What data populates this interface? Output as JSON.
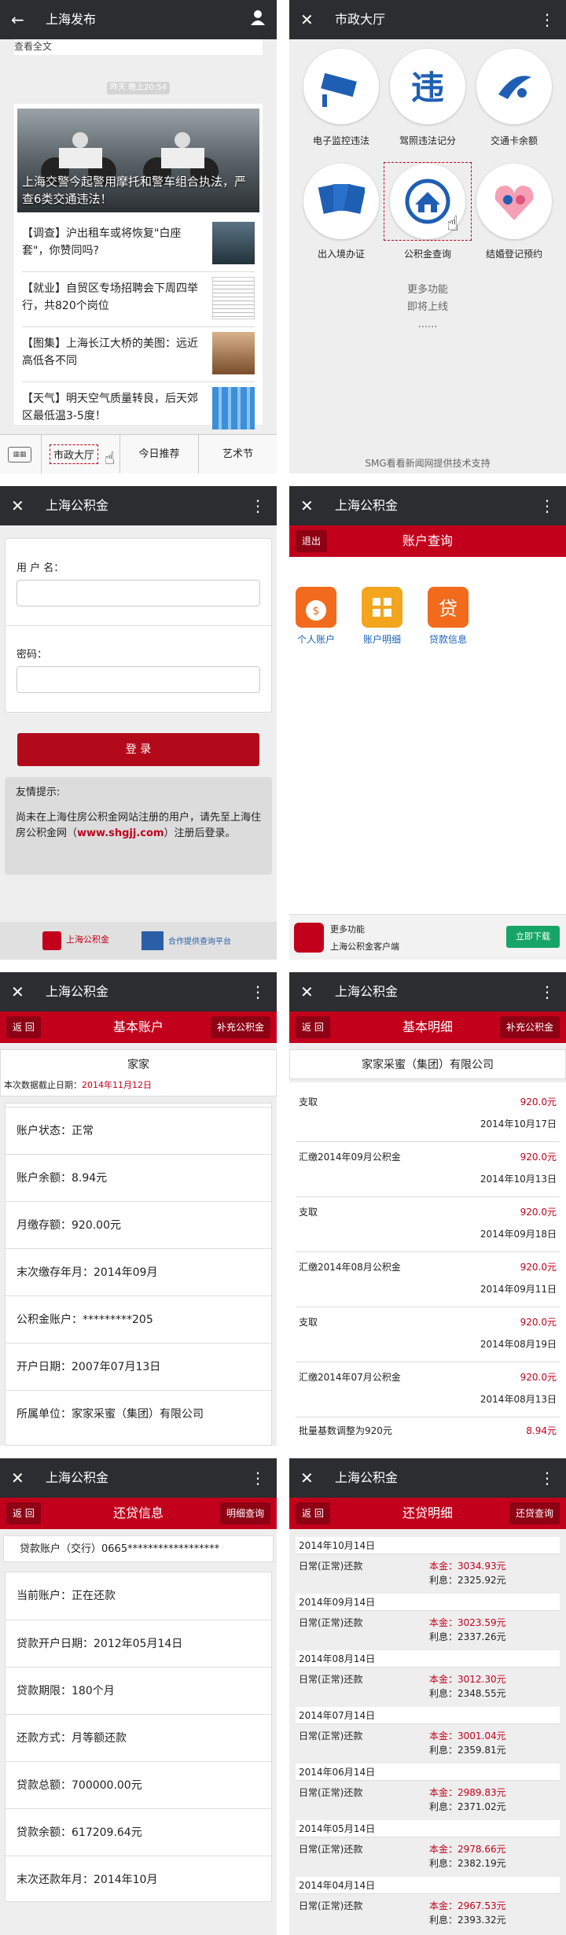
{
  "panel1": {
    "title": "上海发布",
    "top_text": "查看全文",
    "time": "昨天 晚上20:54",
    "headline": "上海交警今起警用摩托和警车组合执法，严查6类交通违法！",
    "items": [
      {
        "text": "【调查】沪出租车或将恢复\"白座套\"，你赞同吗?"
      },
      {
        "text": "【就业】自贸区专场招聘会下周四举行，共820个岗位"
      },
      {
        "text": "【图集】上海长江大桥的美图：远近高低各不同"
      },
      {
        "text": "【天气】明天空气质量转良，后天郊区最低温3-5度！"
      }
    ],
    "menu": [
      "市政大厅",
      "今日推荐",
      "艺术节"
    ]
  },
  "panel2": {
    "title": "市政大厅",
    "icons": [
      {
        "label": "电子监控违法",
        "icon": "camera-icon"
      },
      {
        "label": "驾照违法记分",
        "icon": "violation-icon"
      },
      {
        "label": "交通卡余额",
        "icon": "transport-card-icon"
      },
      {
        "label": "出入境办证",
        "icon": "passport-icon"
      },
      {
        "label": "公积金查询",
        "icon": "housing-fund-icon"
      },
      {
        "label": "结婚登记预约",
        "icon": "marriage-icon"
      }
    ],
    "more1": "更多功能",
    "more2": "即将上线",
    "more3": "......",
    "footer": "SMG看看新闻网提供技术支持"
  },
  "panel3": {
    "title": "上海公积金",
    "user_label": "用 户 名：",
    "pwd_label": "密码：",
    "login": "登 录",
    "tip_title": "友情提示:",
    "tip_text1": "尚未在上海住房公积金网站注册的用户，请先至上海住房公积金网（",
    "tip_link": "www.shgjj.com",
    "tip_text2": "）注册后登录。",
    "foot_left": "上海公积金",
    "foot_right": "合作提供查询平台"
  },
  "panel4": {
    "title": "上海公积金",
    "back": "退出",
    "header": "账户查询",
    "icons": [
      {
        "label": "个人账户",
        "color": "#f26b1d"
      },
      {
        "label": "账户明细",
        "color": "#f2a51d"
      },
      {
        "label": "贷款信息",
        "color": "#f26b1d"
      }
    ],
    "ad_line1": "更多功能",
    "ad_line2": "上海公积金客户端",
    "ad_btn": "立即下载"
  },
  "panel5": {
    "title": "上海公积金",
    "back": "返 回",
    "header": "基本账户",
    "extra": "补充公积金",
    "name": "家家",
    "date_label": "本次数据截止日期：",
    "date": "2014年11月12日",
    "rows": [
      "账户状态：正常",
      "账户余额：8.94元",
      "月缴存额：920.00元",
      "末次缴存年月：2014年09月",
      "公积金账户：*********205",
      "开户日期：2007年07月13日",
      "所属单位：家家采蜜（集团）有限公司"
    ]
  },
  "panel6": {
    "title": "上海公积金",
    "back": "返 回",
    "header": "基本明细",
    "extra": "补充公积金",
    "company": "家家采蜜（集团）有限公司",
    "rows": [
      {
        "type": "支取",
        "amount": "920.0元",
        "date": "2014年10月17日"
      },
      {
        "type": "汇缴2014年09月公积金",
        "amount": "920.0元",
        "date": "2014年10月13日"
      },
      {
        "type": "支取",
        "amount": "920.0元",
        "date": "2014年09月18日"
      },
      {
        "type": "汇缴2014年08月公积金",
        "amount": "920.0元",
        "date": "2014年09月11日"
      },
      {
        "type": "支取",
        "amount": "920.0元",
        "date": "2014年08月19日"
      },
      {
        "type": "汇缴2014年07月公积金",
        "amount": "920.0元",
        "date": "2014年08月13日"
      }
    ],
    "last_type": "批量基数调整为920元",
    "last_amount": "8.94元"
  },
  "panel7": {
    "title": "上海公积金",
    "back": "返 回",
    "header": "还贷信息",
    "extra": "明细查询",
    "account": "贷款账户（交行）0665******************",
    "rows": [
      "当前账户：正在还款",
      "贷款开户日期：2012年05月14日",
      "贷款期限：180个月",
      "还款方式：月等额还款",
      "贷款总额：700000.00元",
      "贷款余额：617209.64元",
      "末次还款年月：2014年10月"
    ]
  },
  "panel8": {
    "title": "上海公积金",
    "back": "返 回",
    "header": "还贷明细",
    "extra": "还贷查询",
    "entries": [
      {
        "date": "2014年10月14日",
        "type": "日常(正常)还款",
        "principal": "本金：3034.93元",
        "interest": "利息：2325.92元"
      },
      {
        "date": "2014年09月14日",
        "type": "日常(正常)还款",
        "principal": "本金：3023.59元",
        "interest": "利息：2337.26元"
      },
      {
        "date": "2014年08月14日",
        "type": "日常(正常)还款",
        "principal": "本金：3012.30元",
        "interest": "利息：2348.55元"
      },
      {
        "date": "2014年07月14日",
        "type": "日常(正常)还款",
        "principal": "本金：3001.04元",
        "interest": "利息：2359.81元"
      },
      {
        "date": "2014年06月14日",
        "type": "日常(正常)还款",
        "principal": "本金：2989.83元",
        "interest": "利息：2371.02元"
      },
      {
        "date": "2014年05月14日",
        "type": "日常(正常)还款",
        "principal": "本金：2978.66元",
        "interest": "利息：2382.19元"
      },
      {
        "date": "2014年04月14日",
        "type": "日常(正常)还款",
        "principal": "本金：2967.53元",
        "interest": "利息：2393.32元"
      }
    ]
  }
}
